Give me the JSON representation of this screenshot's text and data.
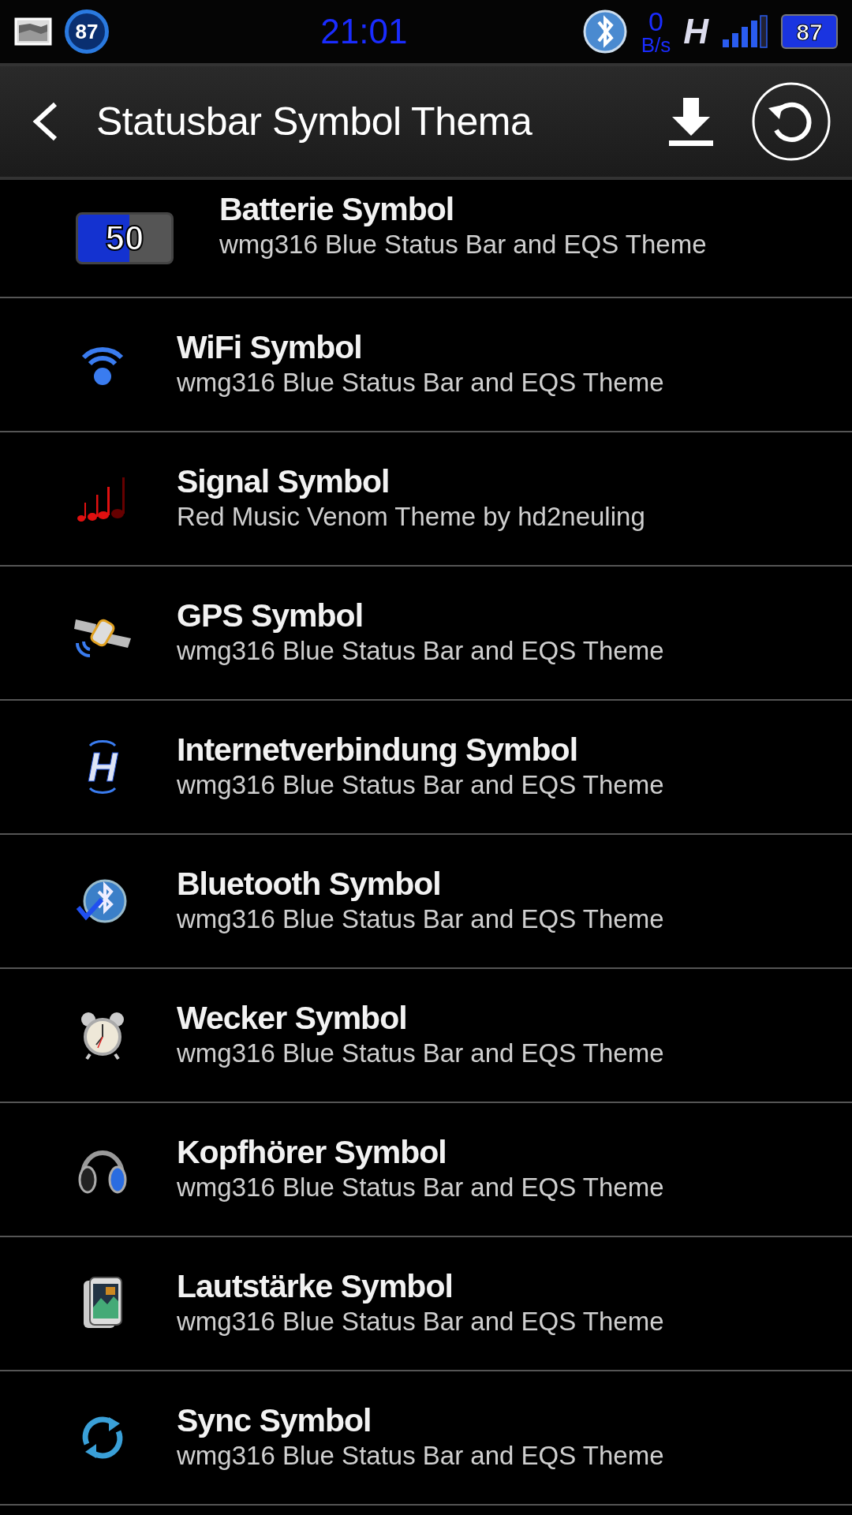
{
  "status_bar": {
    "battery_circle": "87",
    "time": "21:01",
    "speed_value": "0",
    "speed_unit": "B/s",
    "network": "H",
    "battery": "87"
  },
  "header": {
    "title": "Statusbar Symbol Thema"
  },
  "items": [
    {
      "kind": "battery",
      "icon_text": "50",
      "title": "Batterie Symbol",
      "subtitle": "wmg316 Blue Status Bar and EQS Theme"
    },
    {
      "kind": "wifi",
      "title": "WiFi Symbol",
      "subtitle": "wmg316 Blue Status Bar and EQS Theme"
    },
    {
      "kind": "notes",
      "title": "Signal Symbol",
      "subtitle": "Red Music Venom Theme by hd2neuling"
    },
    {
      "kind": "satellite",
      "title": "GPS Symbol",
      "subtitle": "wmg316 Blue Status Bar and EQS Theme"
    },
    {
      "kind": "network",
      "icon_text": "H",
      "title": "Internetverbindung Symbol",
      "subtitle": "wmg316 Blue Status Bar and EQS Theme"
    },
    {
      "kind": "bluetooth",
      "title": "Bluetooth Symbol",
      "subtitle": "wmg316 Blue Status Bar and EQS Theme"
    },
    {
      "kind": "alarm",
      "title": "Wecker Symbol",
      "subtitle": "wmg316 Blue Status Bar and EQS Theme"
    },
    {
      "kind": "headphones",
      "title": "Kopfhörer Symbol",
      "subtitle": "wmg316 Blue Status Bar and EQS Theme"
    },
    {
      "kind": "phone",
      "title": "Lautstärke Symbol",
      "subtitle": "wmg316 Blue Status Bar and EQS Theme"
    },
    {
      "kind": "sync",
      "title": "Sync Symbol",
      "subtitle": "wmg316 Blue Status Bar and EQS Theme"
    }
  ]
}
